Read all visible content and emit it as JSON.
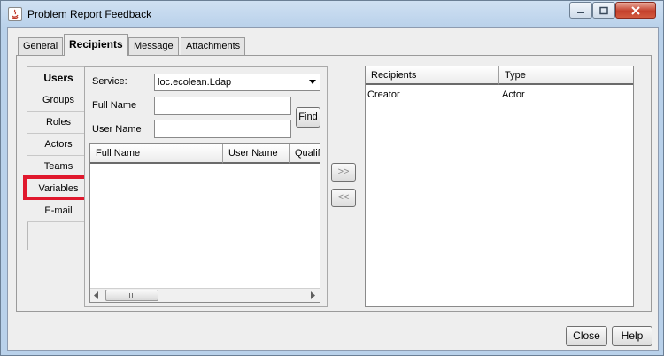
{
  "window": {
    "title": "Problem Report Feedback"
  },
  "tabs": [
    {
      "label": "General",
      "selected": false
    },
    {
      "label": "Recipients",
      "selected": true
    },
    {
      "label": "Message",
      "selected": false
    },
    {
      "label": "Attachments",
      "selected": false
    }
  ],
  "categories": [
    {
      "label": "Users",
      "selected": true
    },
    {
      "label": "Groups",
      "selected": false
    },
    {
      "label": "Roles",
      "selected": false
    },
    {
      "label": "Actors",
      "selected": false
    },
    {
      "label": "Teams",
      "selected": false
    },
    {
      "label": "Variables",
      "selected": false,
      "highlighted": true
    },
    {
      "label": "E-mail",
      "selected": false
    }
  ],
  "users_form": {
    "service_label": "Service:",
    "service_value": "loc.ecolean.Ldap",
    "full_name_label": "Full Name",
    "full_name_value": "",
    "user_name_label": "User Name",
    "user_name_value": "",
    "find_label": "Find"
  },
  "results_table": {
    "columns": [
      "Full Name",
      "User Name",
      "Qualif"
    ],
    "rows": []
  },
  "move_buttons": {
    "add": ">>",
    "remove": "<<"
  },
  "recipients_table": {
    "columns": [
      "Recipients",
      "Type"
    ],
    "rows": [
      {
        "recipient": "Creator",
        "type": "Actor"
      }
    ]
  },
  "footer": {
    "close_label": "Close",
    "help_label": "Help"
  },
  "colors": {
    "highlight": "#e0182d",
    "title_bar": "#b9d1ea",
    "close_button": "#c4402c"
  }
}
